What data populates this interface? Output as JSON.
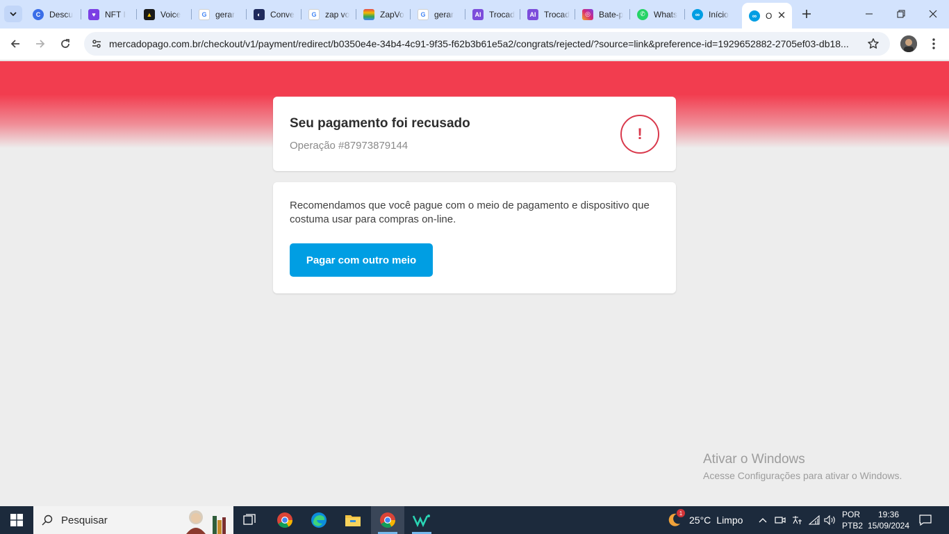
{
  "browser": {
    "tabs": [
      {
        "title": "Descu",
        "icon": "c-circle-icon",
        "color": "#3b6ee8"
      },
      {
        "title": "NFT I",
        "icon": "heart-shield-icon",
        "color": "#7b3fe4"
      },
      {
        "title": "Voice",
        "icon": "triangle-logo-icon",
        "color": "#1a1a1a"
      },
      {
        "title": "gerar",
        "icon": "google-icon",
        "color": "#4285f4"
      },
      {
        "title": "Conve",
        "icon": "portrait-icon",
        "color": "#1f2a5c"
      },
      {
        "title": "zap vo",
        "icon": "google-icon",
        "color": "#4285f4"
      },
      {
        "title": "ZapVo",
        "icon": "rainbow-icon",
        "color": "#e34b4b"
      },
      {
        "title": "gerar",
        "icon": "google-icon",
        "color": "#4285f4"
      },
      {
        "title": "Trocad",
        "icon": "ai-logo-icon",
        "color": "#7c4ddb"
      },
      {
        "title": "Trocad",
        "icon": "ai-logo-icon",
        "color": "#7c4ddb"
      },
      {
        "title": "Bate-p",
        "icon": "instagram-icon",
        "color": "#d62976"
      },
      {
        "title": "Whats",
        "icon": "whatsapp-icon",
        "color": "#25d366"
      },
      {
        "title": "Início",
        "icon": "mercadopago-icon",
        "color": "#009ee3"
      }
    ],
    "active_tab": {
      "title": "O",
      "icon": "mercadopago-icon"
    },
    "url": "mercadopago.com.br/checkout/v1/payment/redirect/b0350e4e-34b4-4c91-9f35-f62b3b61e5a2/congrats/rejected/?source=link&preference-id=1929652882-2705ef03-db18..."
  },
  "page": {
    "status_title": "Seu pagamento foi recusado",
    "operation": "Operação #87973879144",
    "recommendation": "Recomendamos que você pague com o meio de pagamento e dispositivo que costuma usar para compras on-line.",
    "pay_button": "Pagar com outro meio",
    "status_symbol": "!",
    "colors": {
      "hero": "#f23d4f",
      "error": "#d9394c",
      "button": "#009ee3"
    }
  },
  "windows_activation": {
    "title": "Ativar o Windows",
    "subtitle": "Acesse Configurações para ativar o Windows."
  },
  "taskbar": {
    "search_placeholder": "Pesquisar",
    "apps": [
      "task-view-icon",
      "chrome-icon",
      "edge-icon",
      "file-explorer-icon",
      "chrome-icon",
      "app-icon"
    ],
    "weather": {
      "temp": "25°C",
      "condition": "Limpo",
      "badge": "1"
    },
    "lang": {
      "top": "POR",
      "bottom": "PTB2"
    },
    "time": "19:36",
    "date": "15/09/2024"
  }
}
